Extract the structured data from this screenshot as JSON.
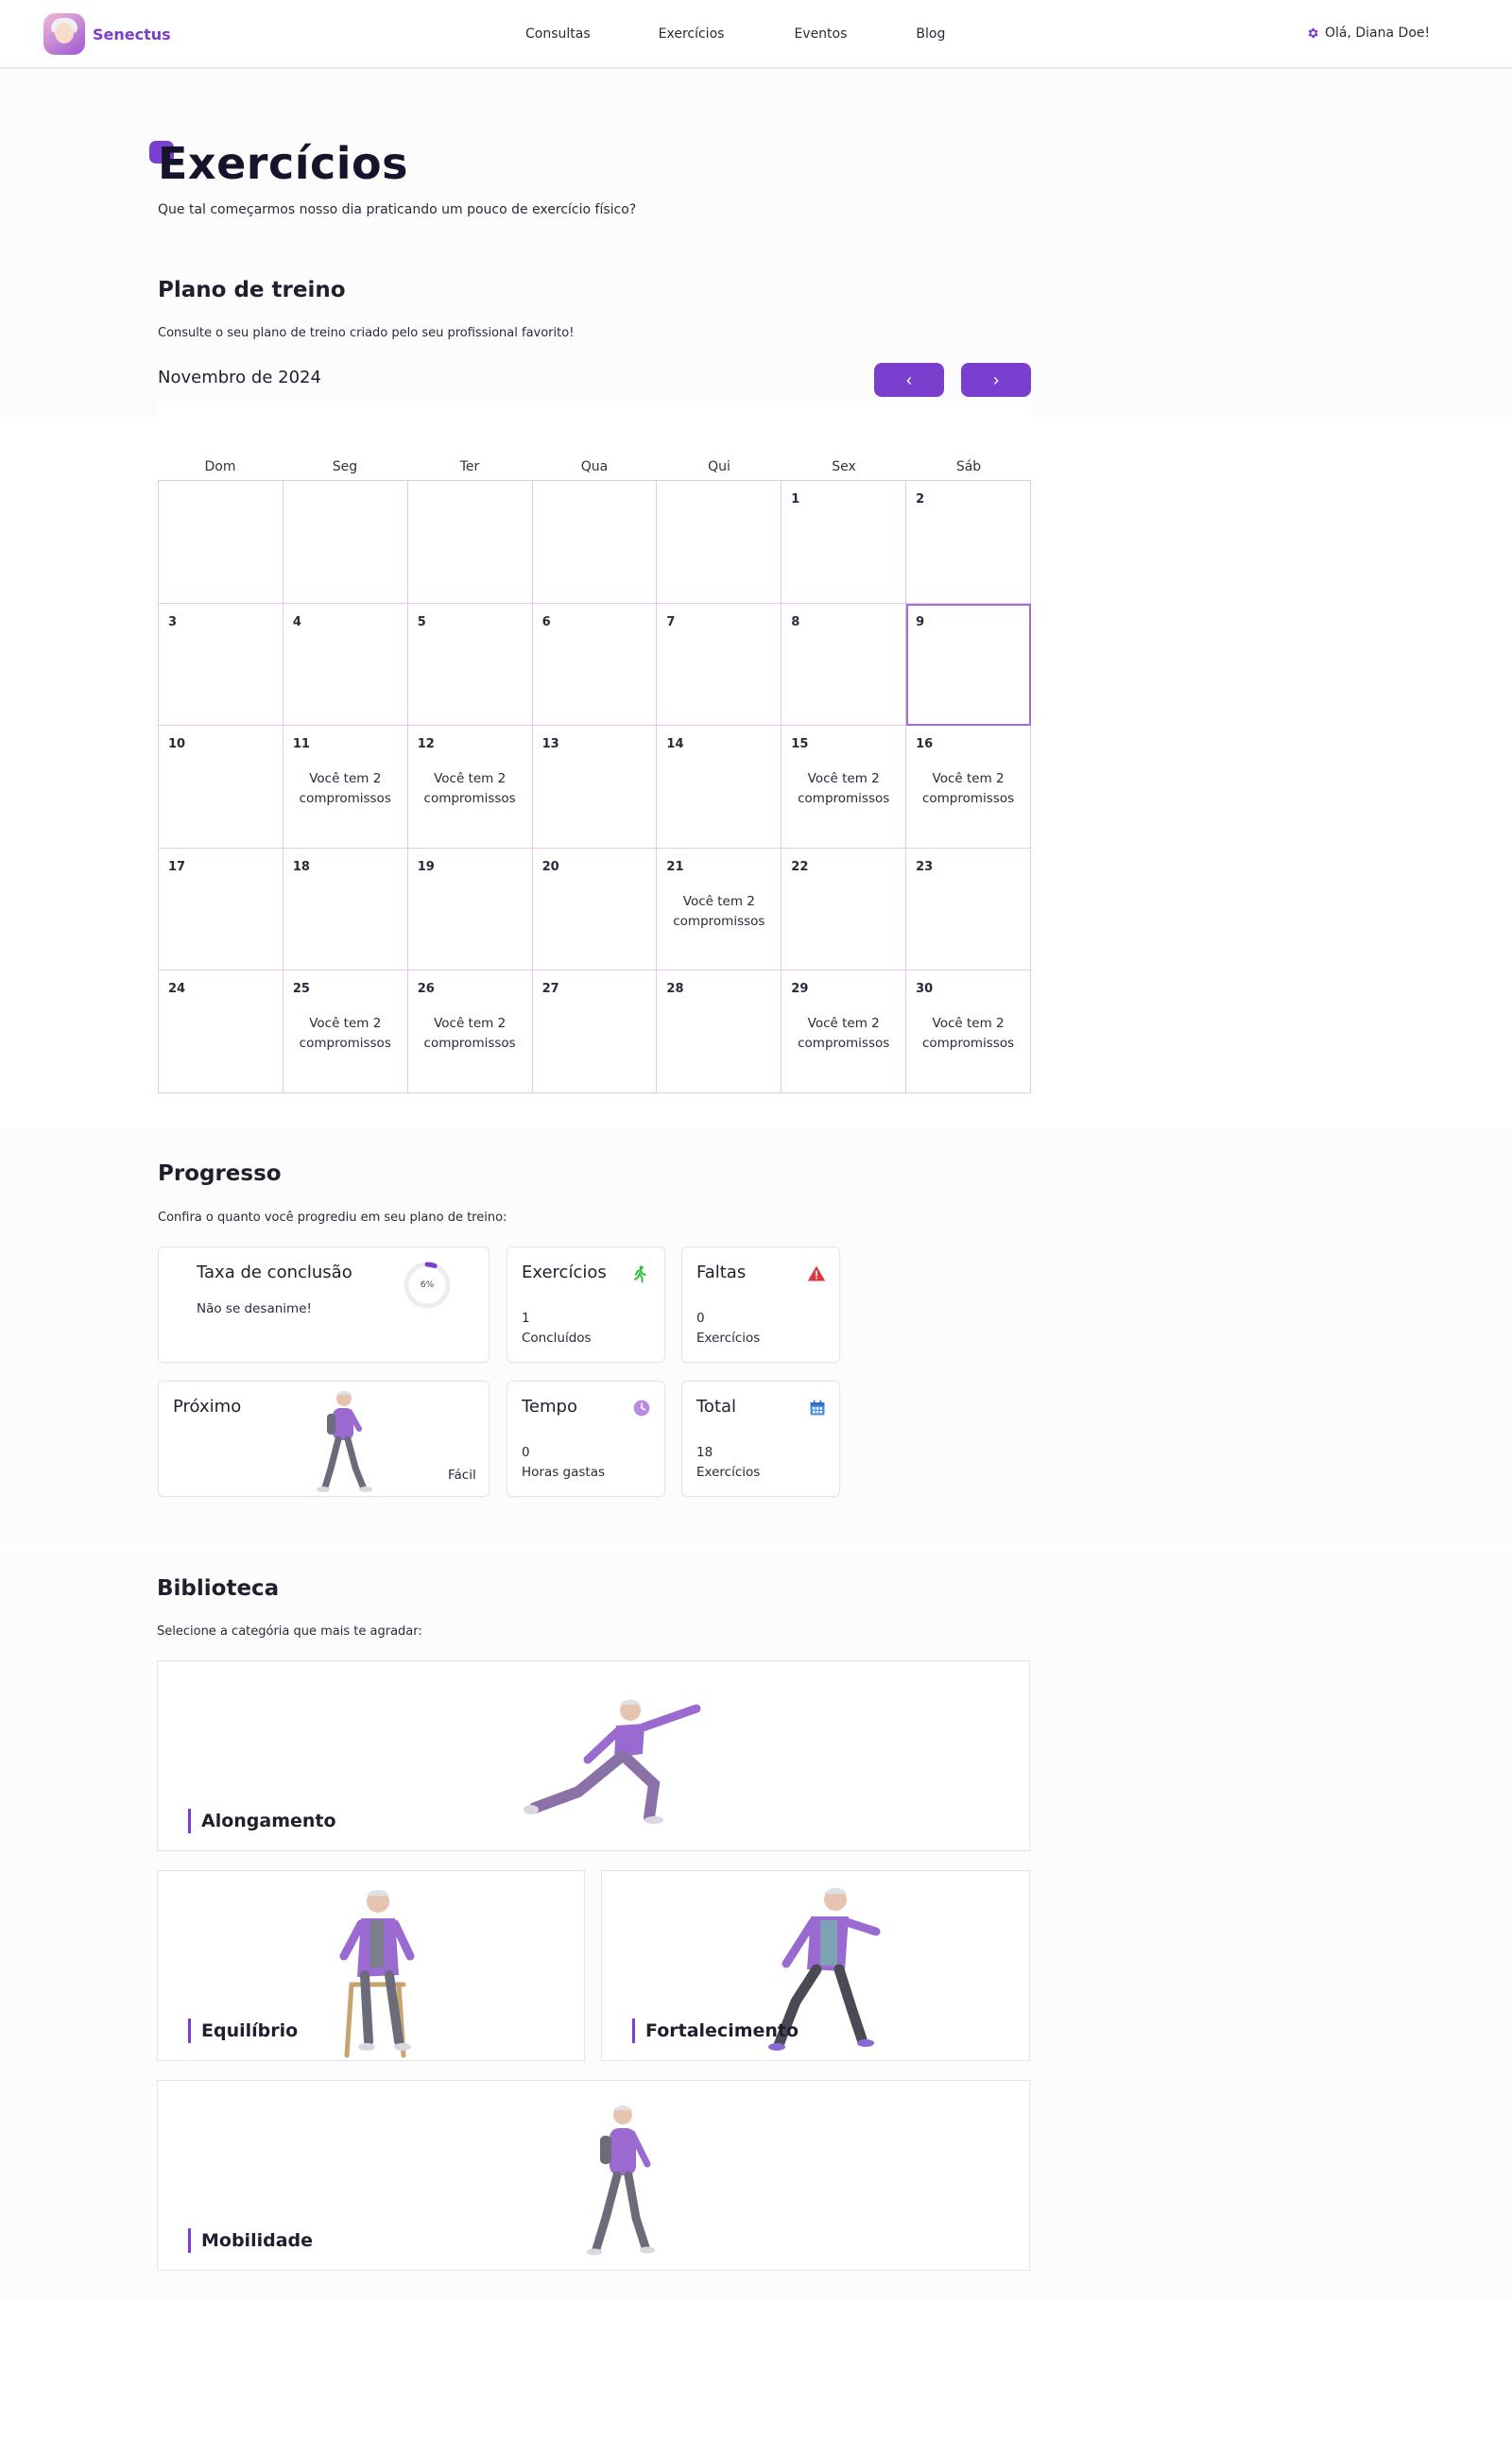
{
  "header": {
    "brand": "Senectus",
    "nav": [
      "Consultas",
      "Exercícios",
      "Eventos",
      "Blog"
    ],
    "greeting": "Olá, Diana Doe!"
  },
  "intro": {
    "title": "Exercícios",
    "subtitle": "Que tal começarmos nosso dia praticando um pouco de exercício físico?"
  },
  "plan": {
    "heading": "Plano de treino",
    "description": "Consulte o seu plano de treino criado pelo seu profissional favorito!",
    "month_label": "Novembro de 2024",
    "prev_label": "‹",
    "next_label": "›",
    "weekdays": [
      "Dom",
      "Seg",
      "Ter",
      "Qua",
      "Qui",
      "Sex",
      "Sáb"
    ],
    "selected_day": 9,
    "event_text": "Você tem 2 compromissos",
    "days": [
      {
        "day": "",
        "event": false
      },
      {
        "day": "",
        "event": false
      },
      {
        "day": "",
        "event": false
      },
      {
        "day": "",
        "event": false
      },
      {
        "day": "",
        "event": false
      },
      {
        "day": "1",
        "event": false
      },
      {
        "day": "2",
        "event": false
      },
      {
        "day": "3",
        "event": false
      },
      {
        "day": "4",
        "event": false
      },
      {
        "day": "5",
        "event": false
      },
      {
        "day": "6",
        "event": false
      },
      {
        "day": "7",
        "event": false
      },
      {
        "day": "8",
        "event": false
      },
      {
        "day": "9",
        "event": false
      },
      {
        "day": "10",
        "event": false
      },
      {
        "day": "11",
        "event": true
      },
      {
        "day": "12",
        "event": true
      },
      {
        "day": "13",
        "event": false
      },
      {
        "day": "14",
        "event": false
      },
      {
        "day": "15",
        "event": true
      },
      {
        "day": "16",
        "event": true
      },
      {
        "day": "17",
        "event": false
      },
      {
        "day": "18",
        "event": false
      },
      {
        "day": "19",
        "event": false
      },
      {
        "day": "20",
        "event": false
      },
      {
        "day": "21",
        "event": true
      },
      {
        "day": "22",
        "event": false
      },
      {
        "day": "23",
        "event": false
      },
      {
        "day": "24",
        "event": false
      },
      {
        "day": "25",
        "event": true
      },
      {
        "day": "26",
        "event": true
      },
      {
        "day": "27",
        "event": false
      },
      {
        "day": "28",
        "event": false
      },
      {
        "day": "29",
        "event": true
      },
      {
        "day": "30",
        "event": true
      }
    ]
  },
  "progress": {
    "heading": "Progresso",
    "description": "Confira o quanto você progrediu em seu plano de treino:",
    "completion": {
      "title": "Taxa de conclusão",
      "message": "Não se desanime!",
      "percent_label": "6%",
      "percent": 6
    },
    "exercises": {
      "title": "Exercícios",
      "value": "1",
      "caption": "Concluídos"
    },
    "absences": {
      "title": "Faltas",
      "value": "0",
      "caption": "Exercícios"
    },
    "next": {
      "title": "Próximo",
      "level": "Fácil"
    },
    "time": {
      "title": "Tempo",
      "value": "0",
      "caption": "Horas gastas"
    },
    "total": {
      "title": "Total",
      "value": "18",
      "caption": "Exercícios"
    }
  },
  "library": {
    "heading": "Biblioteca",
    "description": "Selecione a categória que mais te agradar:",
    "categories": [
      "Alongamento",
      "Equilíbrio",
      "Fortalecimento",
      "Mobilidade"
    ]
  },
  "colors": {
    "accent": "#7a3fce",
    "grid": "#e8c6ee",
    "success": "#2fbf3a",
    "danger": "#e0383e",
    "time": "#b98ae6",
    "calendar": "#4a8fe0"
  }
}
